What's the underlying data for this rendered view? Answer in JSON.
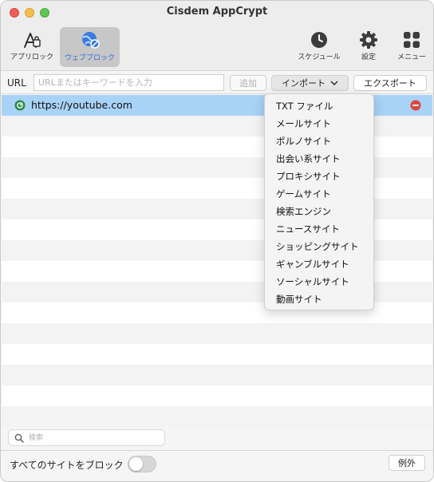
{
  "window": {
    "title": "Cisdem AppCrypt"
  },
  "toolbar": {
    "app_lock": "アプリロック",
    "web_block": "ウェブブロック",
    "schedule": "スケジュール",
    "settings": "設定",
    "menu": "メニュー"
  },
  "url_row": {
    "label": "URL",
    "placeholder": "URLまたはキーワードを入力",
    "add": "追加",
    "import": "インポート",
    "export": "エクスポート"
  },
  "sites": [
    {
      "url": "https://youtube.com"
    }
  ],
  "import_menu": {
    "items": [
      "TXT ファイル",
      "メールサイト",
      "ポルノサイト",
      "出会い系サイト",
      "プロキシサイト",
      "ゲームサイト",
      "検索エンジン",
      "ニュースサイト",
      "ショッピングサイト",
      "ギャンブルサイト",
      "ソーシャルサイト",
      "動画サイト"
    ]
  },
  "search": {
    "placeholder": "検索"
  },
  "footer": {
    "block_all": "すべてのサイトをブロック",
    "block_all_enabled": false,
    "exceptions": "例外"
  },
  "colors": {
    "selection": "#a9d2f7",
    "accent": "#2f6fd6",
    "remove": "#e0443a"
  }
}
